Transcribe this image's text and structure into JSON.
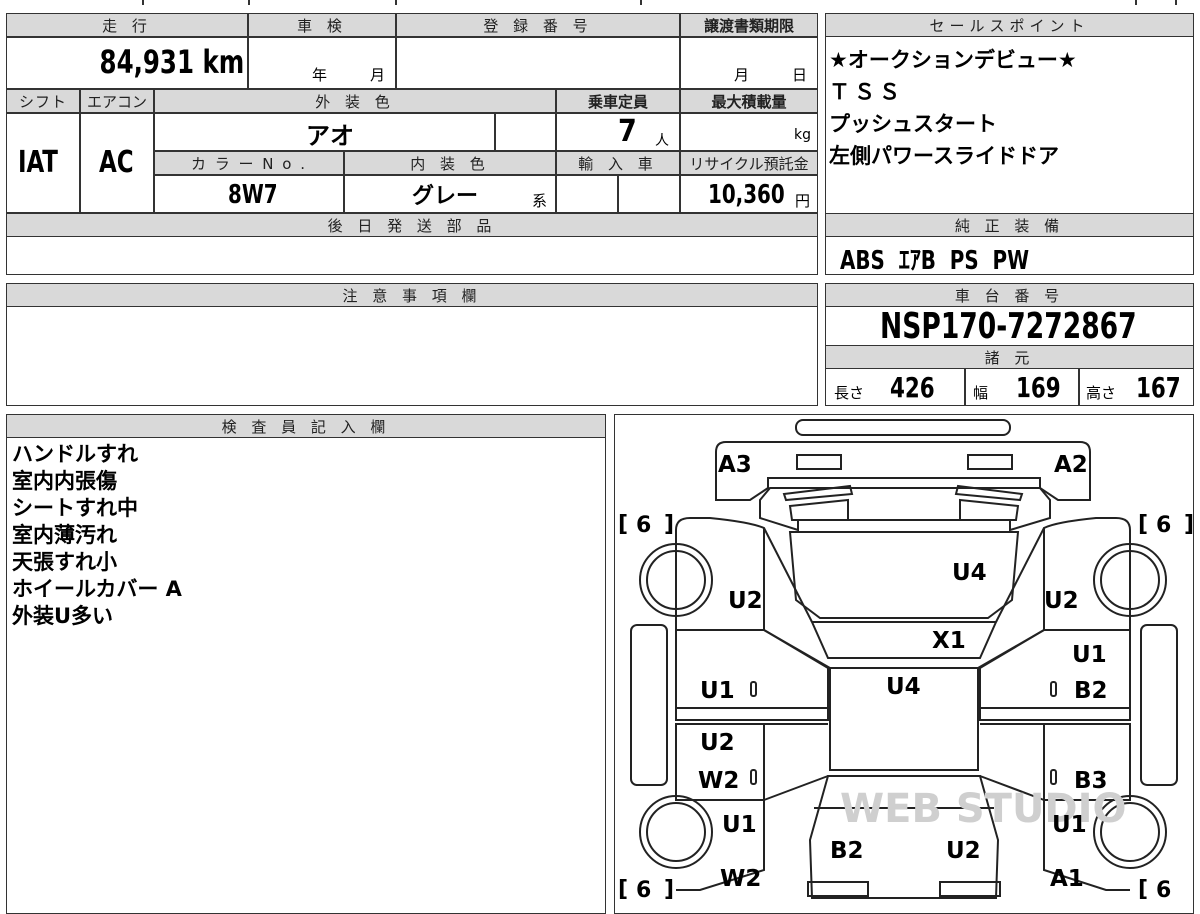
{
  "mileage": {
    "header": "走 行",
    "value": "84,931 km"
  },
  "inspection": {
    "header": "車 検",
    "year_label": "年",
    "month_label": "月"
  },
  "registration": {
    "header": "登 録 番 号",
    "value": ""
  },
  "transfer_deadline": {
    "header": "譲渡書類期限",
    "month_label": "月",
    "day_label": "日"
  },
  "shift": {
    "header": "シフト",
    "value": "IAT"
  },
  "aircon": {
    "header": "エアコン",
    "value": "AC"
  },
  "exterior_color": {
    "header": "外 装 色",
    "value": "アオ"
  },
  "capacity": {
    "header": "乗車定員",
    "value": "7",
    "unit": "人"
  },
  "max_load": {
    "header": "最大積載量",
    "value": "",
    "unit": "kg"
  },
  "color_no": {
    "header": "カ ラ ー N o .",
    "value": "8W7"
  },
  "interior_color": {
    "header": "内 装 色",
    "value": "グレー",
    "suffix": "系"
  },
  "import": {
    "header": "輸 入 車"
  },
  "recycle_fee": {
    "header": "リサイクル預託金",
    "value": "10,360",
    "unit": "円"
  },
  "later_parts": {
    "header": "後 日 発 送 部 品",
    "value": ""
  },
  "sales_points": {
    "header": "セールスポイント",
    "lines": [
      "★オークションデビュー★",
      "ＴＳＳ",
      "プッシュスタート",
      "左側パワースライドドア"
    ]
  },
  "genuine_equipment": {
    "header": "純 正 装 備",
    "value": "ABS  ｴｱB  PS  PW"
  },
  "caution": {
    "header": "注 意 事 項 欄",
    "value": ""
  },
  "chassis": {
    "header": "車 台 番 号",
    "value": "NSP170-7272867"
  },
  "specs": {
    "header": "諸 元",
    "length_label": "長さ",
    "length": "426",
    "width_label": "幅",
    "width": "169",
    "height_label": "高さ",
    "height": "167"
  },
  "inspector_notes": {
    "header": "検 査 員 記 入 欄",
    "lines": [
      "ハンドルすれ",
      "室内内張傷",
      "シートすれ中",
      "室内薄汚れ",
      "天張すれ小",
      "ホイールカバー A",
      "外装U多い"
    ]
  },
  "diagram": {
    "marks": {
      "front_left_corner": "A3",
      "front_right_corner": "A2",
      "bonnet": "U4",
      "left_front_fender": "U2",
      "right_front_fender": "U2",
      "windshield": "X1",
      "roof": "U4",
      "left_front_door": "U1",
      "right_front_door_a": "U1",
      "right_front_door_b": "B2",
      "left_rear_door_a": "U2",
      "left_rear_door_b": "W2",
      "right_rear_door": "B3",
      "left_rear_fender": "U1",
      "right_rear_fender": "U1",
      "tailgate_left": "B2",
      "tailgate_right": "U2",
      "left_rear_quarter": "W2",
      "right_rear_corner": "A1"
    },
    "tire_front_left": "6",
    "tire_front_right": "6",
    "tire_rear_left": "6",
    "tire_rear_right": "6",
    "watermark": "WEB STUDIO"
  }
}
